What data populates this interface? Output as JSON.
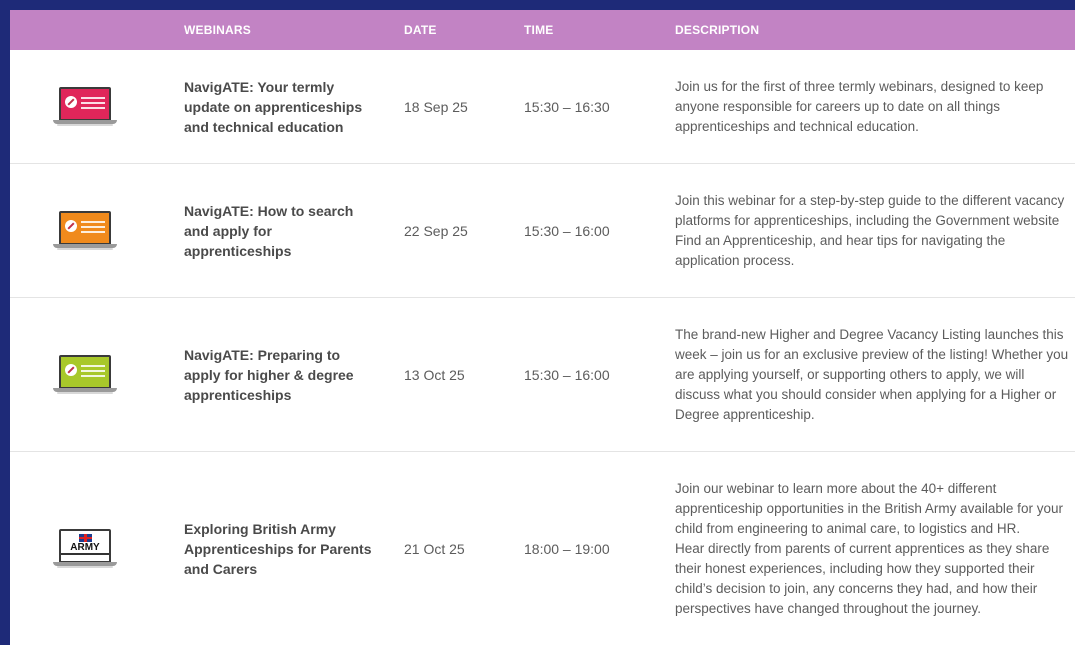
{
  "header": {
    "webinars": "WEBINARS",
    "date": "DATE",
    "time": "TIME",
    "description": "DESCRIPTION"
  },
  "colors": {
    "header_bg": "#c283c4",
    "frame_bg": "#1e2a78",
    "thumb_1": "#e0265a",
    "thumb_2": "#f08a1c",
    "thumb_3": "#a8c82a"
  },
  "rows": [
    {
      "title": "NavigATE: Your termly update on apprenticeships and technical education",
      "date": "18 Sep 25",
      "time": "15:30 – 16:30",
      "description": "Join us for the first of three termly webinars, designed to keep anyone responsible for careers up to date on all things apprenticeships and technical education.",
      "thumbnail_icon": "laptop-icon"
    },
    {
      "title": "NavigATE: How to search and apply for apprenticeships",
      "date": "22 Sep 25",
      "time": "15:30 – 16:00",
      "description": "Join this webinar for a step-by-step guide to the different vacancy platforms for apprenticeships, including the Government website Find an Apprenticeship, and hear tips for navigating the application process.",
      "thumbnail_icon": "laptop-icon"
    },
    {
      "title": "NavigATE: Preparing to apply for higher & degree apprenticeships",
      "date": "13 Oct 25",
      "time": "15:30 – 16:00",
      "description": "The brand-new Higher and Degree Vacancy Listing launches this week – join us for an exclusive preview of the listing! Whether you are applying yourself, or supporting others to apply, we will discuss what you should consider when applying for a Higher or Degree apprenticeship.",
      "thumbnail_icon": "laptop-icon"
    },
    {
      "title": "Exploring British Army Apprenticeships for Parents and Carers",
      "date": "21 Oct 25",
      "time": "18:00 – 19:00",
      "description": "Join our webinar to learn more about the 40+ different apprenticeship opportunities in the British Army available for your child from engineering to animal care, to logistics and HR.\nHear directly from parents of current apprentices as they share their honest experiences, including how they supported their child’s decision to join, any concerns they had, and how their perspectives have changed throughout the journey.",
      "thumbnail_icon": "army-laptop-icon",
      "logo_text": "ARMY"
    }
  ]
}
